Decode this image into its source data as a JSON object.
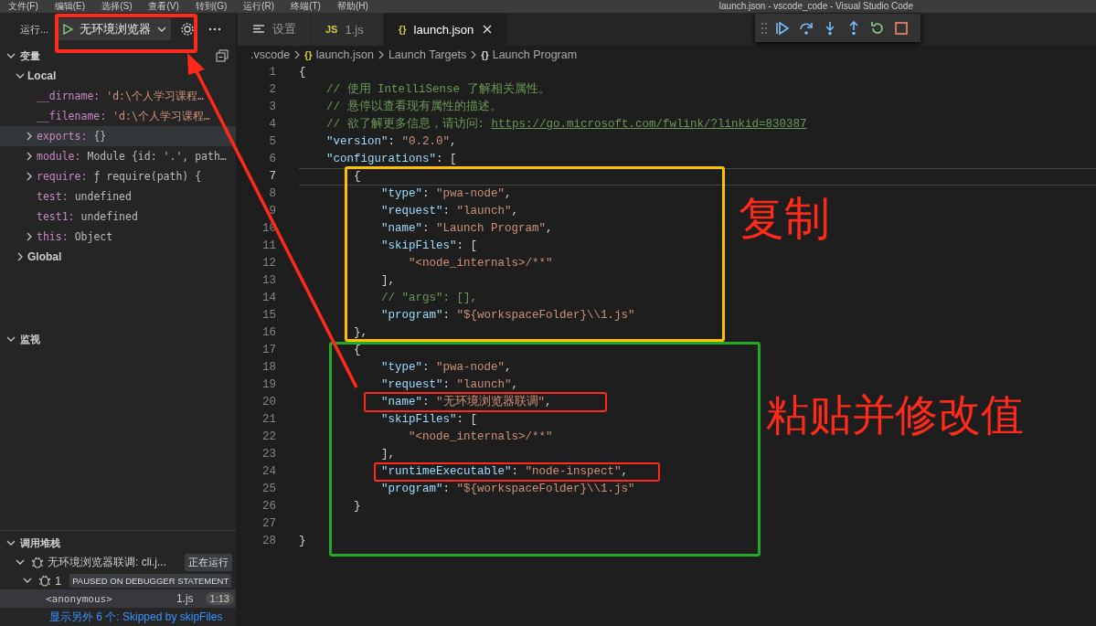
{
  "title_bar": {
    "menu": [
      "文件(F)",
      "编辑(E)",
      "选择(S)",
      "查看(V)",
      "转到(G)",
      "运行(R)",
      "终端(T)",
      "帮助(H)"
    ],
    "title": "launch.json - vscode_code - Visual Studio Code"
  },
  "run_view": {
    "label": "运行...",
    "configuration": "无环境浏览器"
  },
  "variables": {
    "title": "变量",
    "expanded": true,
    "scopes": [
      {
        "name": "Local",
        "expanded": true,
        "children": [
          {
            "name": "__dirname:",
            "value": {
              "kind": "string",
              "text": "'d:\\个人学习课程…"
            },
            "kind": "leaf",
            "highlighted": false
          },
          {
            "name": "__filename:",
            "value": {
              "kind": "string",
              "text": "'d:\\个人学习课程…"
            },
            "kind": "leaf",
            "highlighted": false
          },
          {
            "name": "exports:",
            "value": {
              "kind": "object",
              "text": "{}"
            },
            "kind": "node",
            "expanded": false,
            "highlighted": true
          },
          {
            "name": "module:",
            "value": {
              "kind": "object",
              "text": "Module {id: '.', path…"
            },
            "kind": "node",
            "expanded": false,
            "highlighted": false
          },
          {
            "name": "require:",
            "value": {
              "kind": "function",
              "text": "ƒ require(path) {"
            },
            "kind": "node",
            "expanded": false,
            "highlighted": false
          },
          {
            "name": "test:",
            "value": {
              "kind": "object",
              "text": "undefined"
            },
            "kind": "leaf",
            "highlighted": false
          },
          {
            "name": "test1:",
            "value": {
              "kind": "object",
              "text": "undefined"
            },
            "kind": "leaf",
            "highlighted": false
          },
          {
            "name": "this:",
            "value": {
              "kind": "object",
              "text": "Object"
            },
            "kind": "node",
            "expanded": false,
            "highlighted": false
          }
        ]
      },
      {
        "name": "Global",
        "expanded": false
      }
    ]
  },
  "watch": {
    "title": "监视",
    "expanded": true
  },
  "call_stack": {
    "title": "调用堆栈",
    "expanded": true,
    "sessions": [
      {
        "name": "无环境浏览器联调: cli.j...",
        "status": "正在运行",
        "expanded": true,
        "threads": [
          {
            "name": "1",
            "status": "PAUSED ON DEBUGGER STATEMENT",
            "expanded": true,
            "frames": [
              {
                "name": "<anonymous>",
                "file": "1.js",
                "position": "1:13",
                "selected": true
              }
            ],
            "skipped": "显示另外 6 个: Skipped by skipFiles"
          }
        ]
      }
    ]
  },
  "tabs": [
    {
      "kind": "settings",
      "label": "设置",
      "selected": false
    },
    {
      "icon": "JS",
      "kind": "js",
      "label": "1.js",
      "selected": false
    },
    {
      "icon": "{}",
      "kind": "json",
      "label": "launch.json",
      "selected": true
    }
  ],
  "breadcrumb": [
    {
      "kind": "folder",
      "text": ".vscode"
    },
    {
      "kind": "file",
      "icon": "{}",
      "text": "launch.json"
    },
    {
      "kind": "group",
      "text": "Launch Targets"
    },
    {
      "kind": "symbol",
      "icon": "{}",
      "text": "Launch Program"
    }
  ],
  "code_lines": [
    {
      "number": "1",
      "current": false,
      "tokens": [
        {
          "kind": "punct",
          "text": "{"
        }
      ]
    },
    {
      "number": "2",
      "current": false,
      "tokens": [
        {
          "kind": "comment",
          "text": "    // 使用 IntelliSense 了解相关属性。"
        }
      ]
    },
    {
      "number": "3",
      "current": false,
      "tokens": [
        {
          "kind": "comment",
          "text": "    // 悬停以查看现有属性的描述。"
        }
      ]
    },
    {
      "number": "4",
      "current": false,
      "tokens": [
        {
          "kind": "comment",
          "text": "    // 欲了解更多信息，请访问: "
        },
        {
          "kind": "link",
          "text": "https://go.microsoft.com/fwlink/?linkid=830387"
        }
      ]
    },
    {
      "number": "5",
      "current": false,
      "tokens": [
        {
          "kind": "key",
          "text": "    \"version\""
        },
        {
          "kind": "punct",
          "text": ": "
        },
        {
          "kind": "string",
          "text": "\"0.2.0\""
        },
        {
          "kind": "punct",
          "text": ","
        }
      ]
    },
    {
      "number": "6",
      "current": false,
      "tokens": [
        {
          "kind": "key",
          "text": "    \"configurations\""
        },
        {
          "kind": "punct",
          "text": ": ["
        }
      ]
    },
    {
      "number": "7",
      "current": true,
      "tokens": [
        {
          "kind": "punct",
          "text": "        {"
        }
      ]
    },
    {
      "number": "8",
      "current": false,
      "tokens": [
        {
          "kind": "key",
          "text": "            \"type\""
        },
        {
          "kind": "punct",
          "text": ": "
        },
        {
          "kind": "string",
          "text": "\"pwa-node\""
        },
        {
          "kind": "punct",
          "text": ","
        }
      ]
    },
    {
      "number": "9",
      "current": false,
      "tokens": [
        {
          "kind": "key",
          "text": "            \"request\""
        },
        {
          "kind": "punct",
          "text": ": "
        },
        {
          "kind": "string",
          "text": "\"launch\""
        },
        {
          "kind": "punct",
          "text": ","
        }
      ]
    },
    {
      "number": "10",
      "current": false,
      "tokens": [
        {
          "kind": "key",
          "text": "            \"name\""
        },
        {
          "kind": "punct",
          "text": ": "
        },
        {
          "kind": "string",
          "text": "\"Launch Program\""
        },
        {
          "kind": "punct",
          "text": ","
        }
      ]
    },
    {
      "number": "11",
      "current": false,
      "tokens": [
        {
          "kind": "key",
          "text": "            \"skipFiles\""
        },
        {
          "kind": "punct",
          "text": ": ["
        }
      ]
    },
    {
      "number": "12",
      "current": false,
      "tokens": [
        {
          "kind": "string",
          "text": "                \"<node_internals>/**\""
        }
      ]
    },
    {
      "number": "13",
      "current": false,
      "tokens": [
        {
          "kind": "punct",
          "text": "            ],"
        }
      ]
    },
    {
      "number": "14",
      "current": false,
      "tokens": [
        {
          "kind": "comment",
          "text": "            // \"args\": [],"
        }
      ]
    },
    {
      "number": "15",
      "current": false,
      "tokens": [
        {
          "kind": "key",
          "text": "            \"program\""
        },
        {
          "kind": "punct",
          "text": ": "
        },
        {
          "kind": "string",
          "text": "\"${workspaceFolder}\\\\1.js\""
        }
      ]
    },
    {
      "number": "16",
      "current": false,
      "tokens": [
        {
          "kind": "punct",
          "text": "        },"
        }
      ]
    },
    {
      "number": "17",
      "current": false,
      "tokens": [
        {
          "kind": "punct",
          "text": "        {"
        }
      ]
    },
    {
      "number": "18",
      "current": false,
      "tokens": [
        {
          "kind": "key",
          "text": "            \"type\""
        },
        {
          "kind": "punct",
          "text": ": "
        },
        {
          "kind": "string",
          "text": "\"pwa-node\""
        },
        {
          "kind": "punct",
          "text": ","
        }
      ]
    },
    {
      "number": "19",
      "current": false,
      "tokens": [
        {
          "kind": "key",
          "text": "            \"request\""
        },
        {
          "kind": "punct",
          "text": ": "
        },
        {
          "kind": "string",
          "text": "\"launch\""
        },
        {
          "kind": "punct",
          "text": ","
        }
      ]
    },
    {
      "number": "20",
      "current": false,
      "tokens": [
        {
          "kind": "key",
          "text": "            \"name\""
        },
        {
          "kind": "punct",
          "text": ": "
        },
        {
          "kind": "string",
          "text": "\"无环境浏览器联调\""
        },
        {
          "kind": "punct",
          "text": ","
        }
      ]
    },
    {
      "number": "21",
      "current": false,
      "tokens": [
        {
          "kind": "key",
          "text": "            \"skipFiles\""
        },
        {
          "kind": "punct",
          "text": ": ["
        }
      ]
    },
    {
      "number": "22",
      "current": false,
      "tokens": [
        {
          "kind": "string",
          "text": "                \"<node_internals>/**\""
        }
      ]
    },
    {
      "number": "23",
      "current": false,
      "tokens": [
        {
          "kind": "punct",
          "text": "            ],"
        }
      ]
    },
    {
      "number": "24",
      "current": false,
      "tokens": [
        {
          "kind": "key",
          "text": "            \"runtimeExecutable\""
        },
        {
          "kind": "punct",
          "text": ": "
        },
        {
          "kind": "string",
          "text": "\"node-inspect\""
        },
        {
          "kind": "punct",
          "text": ","
        }
      ]
    },
    {
      "number": "25",
      "current": false,
      "tokens": [
        {
          "kind": "key",
          "text": "            \"program\""
        },
        {
          "kind": "punct",
          "text": ": "
        },
        {
          "kind": "string",
          "text": "\"${workspaceFolder}\\\\1.js\""
        }
      ]
    },
    {
      "number": "26",
      "current": false,
      "tokens": [
        {
          "kind": "punct",
          "text": "        }"
        }
      ]
    },
    {
      "number": "27",
      "current": false
    },
    {
      "number": "28",
      "current": false,
      "tokens": [
        {
          "kind": "punct",
          "text": "}"
        }
      ]
    }
  ],
  "annotations": {
    "boxes": [
      {
        "color": "#ff2a1a"
      },
      {
        "color": "#ffc000"
      },
      {
        "color": "#22a822"
      },
      {
        "color": "#ff2a1a"
      },
      {
        "color": "#ff2a1a"
      }
    ],
    "labels": [
      {
        "text": "复制",
        "color": "#ff2a1a"
      },
      {
        "text": "粘贴并修改值",
        "color": "#ff2a1a"
      }
    ]
  }
}
